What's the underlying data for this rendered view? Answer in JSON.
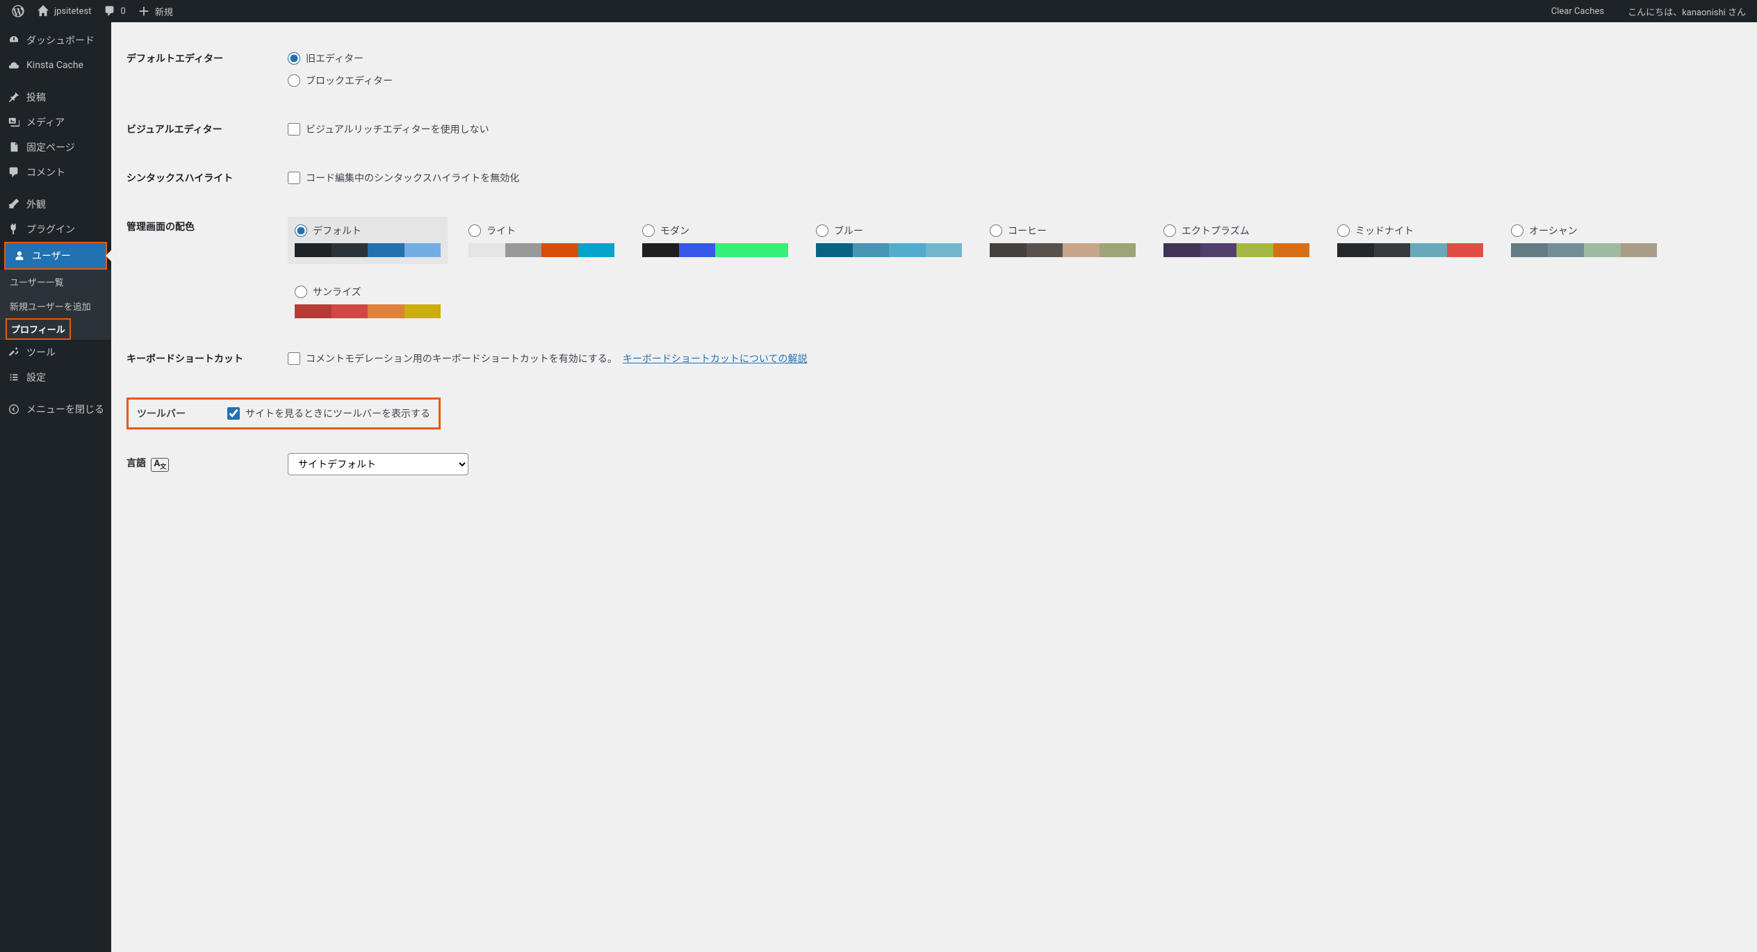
{
  "adminbar": {
    "site_name": "jpsitetest",
    "comments_count": "0",
    "new_label": "新規",
    "clear_caches": "Clear Caches",
    "greeting": "こんにちは、kanaonishi さん"
  },
  "sidebar": {
    "dashboard": "ダッシュボード",
    "kinsta_cache": "Kinsta Cache",
    "posts": "投稿",
    "media": "メディア",
    "pages": "固定ページ",
    "comments": "コメント",
    "appearance": "外観",
    "plugins": "プラグイン",
    "users": "ユーザー",
    "users_sub": {
      "all": "ユーザー一覧",
      "add": "新規ユーザーを追加",
      "profile": "プロフィール"
    },
    "tools": "ツール",
    "settings": "設定",
    "collapse": "メニューを閉じる"
  },
  "form": {
    "default_editor": {
      "label": "デフォルトエディター",
      "classic": "旧エディター",
      "block": "ブロックエディター"
    },
    "visual_editor": {
      "label": "ビジュアルエディター",
      "disable": "ビジュアルリッチエディターを使用しない"
    },
    "syntax": {
      "label": "シンタックスハイライト",
      "disable": "コード編集中のシンタックスハイライトを無効化"
    },
    "color_scheme": {
      "label": "管理画面の配色",
      "schemes": [
        {
          "name": "デフォルト",
          "colors": [
            "#1d2327",
            "#2c3338",
            "#2271b1",
            "#72aee6"
          ],
          "selected": true
        },
        {
          "name": "ライト",
          "colors": [
            "#e5e5e5",
            "#999999",
            "#d64e07",
            "#04a4cc"
          ],
          "selected": false
        },
        {
          "name": "モダン",
          "colors": [
            "#1e1e1e",
            "#3858e9",
            "#33f078",
            "#33f078"
          ],
          "selected": false
        },
        {
          "name": "ブルー",
          "colors": [
            "#096484",
            "#4796b3",
            "#52accc",
            "#74b6ce"
          ],
          "selected": false
        },
        {
          "name": "コーヒー",
          "colors": [
            "#46403c",
            "#59524c",
            "#c7a589",
            "#9ea476"
          ],
          "selected": false
        },
        {
          "name": "エクトプラズム",
          "colors": [
            "#413256",
            "#523f6d",
            "#a3b745",
            "#d46f15"
          ],
          "selected": false
        },
        {
          "name": "ミッドナイト",
          "colors": [
            "#25282b",
            "#363b3f",
            "#69a8bb",
            "#e14d43"
          ],
          "selected": false
        },
        {
          "name": "オーシャン",
          "colors": [
            "#627c83",
            "#738e96",
            "#9ebaa0",
            "#aa9d88"
          ],
          "selected": false
        },
        {
          "name": "サンライズ",
          "colors": [
            "#b43c38",
            "#cf4944",
            "#dd823b",
            "#ccaf0b"
          ],
          "selected": false
        }
      ]
    },
    "keyboard": {
      "label": "キーボードショートカット",
      "text": "コメントモデレーション用のキーボードショートカットを有効にする。",
      "link": "キーボードショートカットについての解説"
    },
    "toolbar": {
      "label": "ツールバー",
      "text": "サイトを見るときにツールバーを表示する"
    },
    "language": {
      "label": "言語",
      "value": "サイトデフォルト"
    }
  }
}
